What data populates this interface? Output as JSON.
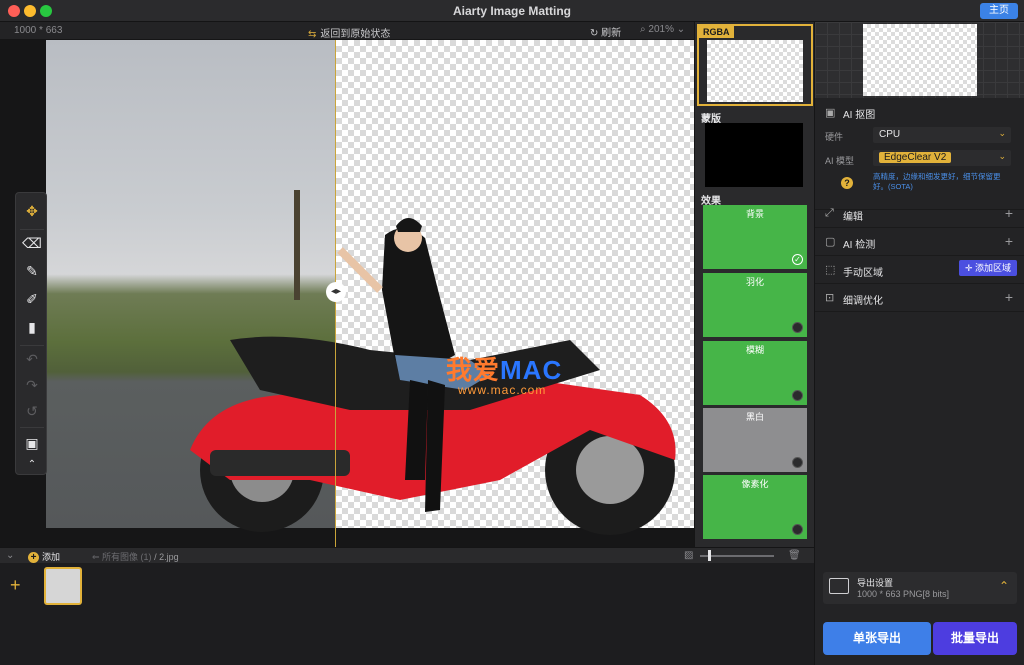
{
  "window": {
    "title": "Aiarty Image Matting",
    "home_label": "主页"
  },
  "canvas_bar": {
    "dims": "1000 *  663",
    "restore_label": "返回到原始状态",
    "refresh_label": "刷新",
    "zoom": "201%"
  },
  "watermark": {
    "text_a": "我爱",
    "text_b": "MAC",
    "url": "www.mac.com"
  },
  "previews": {
    "rgba_tag": "RGBA",
    "mask_label": "蒙版",
    "effects_label": "效果",
    "effects": [
      {
        "name": "背景",
        "selected": true
      },
      {
        "name": "羽化",
        "selected": false
      },
      {
        "name": "模糊",
        "selected": false
      },
      {
        "name": "黑白",
        "selected": false
      },
      {
        "name": "像素化",
        "selected": false
      }
    ]
  },
  "right_panel": {
    "ai_matting_label": "AI 抠图",
    "hardware_label": "硬件",
    "hardware_value": "CPU",
    "model_label": "AI 模型",
    "model_value": "EdgeClear  V2",
    "model_desc": "高精度，边缘和细发更好，细节保留更好。(SOTA)",
    "edit_label": "编辑",
    "ai_detect_label": "AI 检测",
    "manual_area_label": "手动区域",
    "add_area_label": "添加区域",
    "fine_tune_label": "细调优化",
    "export_settings_label": "导出设置",
    "export_settings_value": "1000 *  663 PNG[8 bits]",
    "single_export_label": "单张导出",
    "batch_export_label": "批量导出"
  },
  "bottom": {
    "add_label": "添加",
    "crumb_all": "所有图像 (1)",
    "crumb_file": "/ 2.jpg"
  },
  "colors": {
    "accent": "#e2b23a",
    "primary_blue": "#3e7fe8",
    "batch_purple": "#4d3de0",
    "effect_green": "#46b548"
  },
  "icons": [
    "move-tool-icon",
    "eraser-icon",
    "brush-icon",
    "restore-brush-icon",
    "paint-roller-icon",
    "undo-icon",
    "redo-icon",
    "reset-icon",
    "fit-screen-icon",
    "collapse-icon"
  ]
}
